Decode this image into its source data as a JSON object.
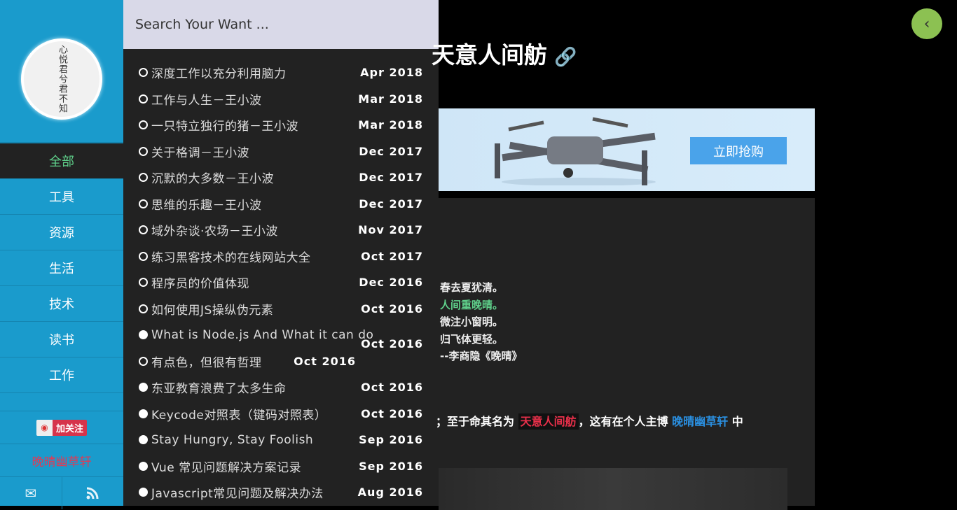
{
  "sidebar": {
    "avatar_text": "心悦君兮君不知",
    "items": [
      {
        "label": "全部"
      },
      {
        "label": "工具"
      },
      {
        "label": "资源"
      },
      {
        "label": "生活"
      },
      {
        "label": "技术"
      },
      {
        "label": "读书"
      },
      {
        "label": "工作"
      }
    ],
    "weibo_label": "加关注",
    "site_name": "晚晴幽草轩"
  },
  "search": {
    "placeholder": "Search Your Want ...",
    "results": [
      {
        "title": "深度工作以充分利用脑力",
        "date": "Apr 2018"
      },
      {
        "title": "工作与人生－王小波",
        "date": "Mar 2018"
      },
      {
        "title": "一只特立独行的猪－王小波",
        "date": "Mar 2018"
      },
      {
        "title": "关于格调－王小波",
        "date": "Dec 2017"
      },
      {
        "title": "沉默的大多数－王小波",
        "date": "Dec 2017"
      },
      {
        "title": "思维的乐趣－王小波",
        "date": "Dec 2017"
      },
      {
        "title": "域外杂谈·农场－王小波",
        "date": "Nov 2017"
      },
      {
        "title": "练习黑客技术的在线网站大全",
        "date": "Oct 2017"
      },
      {
        "title": "程序员的价值体现",
        "date": "Dec 2016"
      },
      {
        "title": "如何使用JS操纵伪元素",
        "date": "Oct 2016"
      },
      {
        "title": "What is Node.js And What it can do",
        "date": "Oct 2016"
      },
      {
        "title": "有点色，但很有哲理",
        "date": "Oct 2016"
      },
      {
        "title": "东亚教育浪费了太多生命",
        "date": "Oct 2016"
      },
      {
        "title": "Keycode对照表（键码对照表）",
        "date": "Oct 2016"
      },
      {
        "title": "Stay Hungry, Stay Foolish",
        "date": "Sep 2016"
      },
      {
        "title": "Vue 常见问题解决方案记录",
        "date": "Sep 2016"
      },
      {
        "title": "Javascript常见问题及解决办法",
        "date": "Aug 2016"
      }
    ]
  },
  "main": {
    "title": "天意人间舫",
    "banner_button": "立即抢购",
    "poem": [
      "春去夏犹清。",
      "人间重晚晴。",
      "微注小窗明。",
      "归飞体更轻。",
      "--李商隐《晚晴》"
    ],
    "para": {
      "p1": "；至于命其名为 ",
      "highlight": "天意人间舫",
      "p2": "，这有在个人主博 ",
      "link": "晚晴幽草轩",
      "p3": " 中"
    }
  },
  "colors": {
    "sidebar": "#1a9bcc",
    "accent_green": "#5fcf8a",
    "back_button": "#8cc152"
  }
}
